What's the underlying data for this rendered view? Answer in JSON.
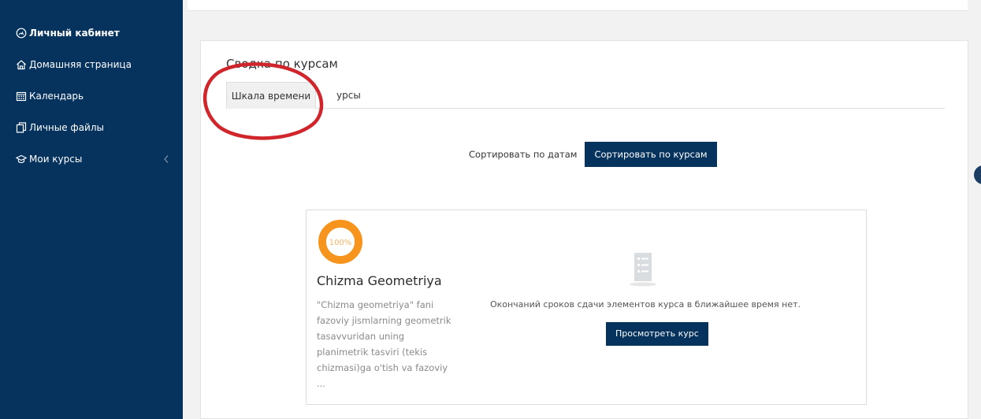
{
  "sidebar": {
    "items": [
      {
        "label": "Личный кабинет",
        "icon": "dashboard-icon"
      },
      {
        "label": "Домашняя страница",
        "icon": "home-icon"
      },
      {
        "label": "Календарь",
        "icon": "calendar-icon"
      },
      {
        "label": "Личные файлы",
        "icon": "files-icon"
      },
      {
        "label": "Мои курсы",
        "icon": "graduation-cap-icon"
      }
    ]
  },
  "overview": {
    "title": "Сводка по курсам",
    "tabs": [
      {
        "label": "Шкала времени",
        "active": true
      },
      {
        "label": "урсы",
        "active": false
      }
    ],
    "sort_by_dates": "Сортировать по датам",
    "sort_by_courses": "Сортировать по курсам"
  },
  "course": {
    "progress_label": "100%",
    "progress_value": 100,
    "name": "Chizma Geometriya",
    "description": "\"Chizma geometriya\" fani fazoviy jismlarning geometrik tasavvuridan uning planimetrik tasviri (tekis chizmasi)ga o'tish va fazoviy ...",
    "empty_message": "Окончаний сроков сдачи элементов курса в ближайшее время нет.",
    "view_button": "Просмотреть курс"
  },
  "colors": {
    "sidebar_bg": "#06335e",
    "button_bg": "#06335e",
    "progress_orange": "#f7941d",
    "annotation_red": "#d0262b"
  }
}
